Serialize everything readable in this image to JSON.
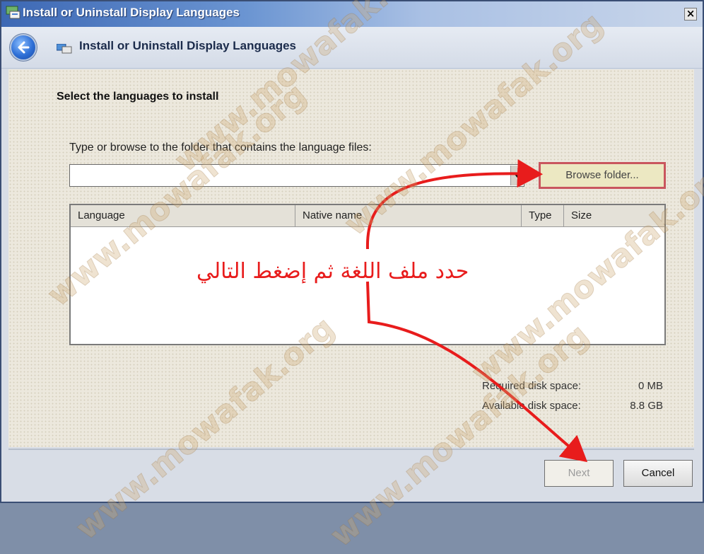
{
  "window": {
    "title": "Install or Uninstall Display Languages",
    "close_glyph": "×"
  },
  "navbar": {
    "back_icon": "back-arrow-icon",
    "title": "Install or Uninstall Display Languages"
  },
  "main": {
    "heading": "Select the languages to install",
    "folder_prompt": "Type or browse to the folder that contains the language files:",
    "folder_path_value": "",
    "browse_label": "Browse folder...",
    "columns": [
      "Language",
      "Native name",
      "Type",
      "Size"
    ],
    "rows": [],
    "required_label": "Required disk space:",
    "required_value": "0 MB",
    "available_label": "Available disk space:",
    "available_value": "8.8 GB"
  },
  "footer": {
    "next_label": "Next",
    "cancel_label": "Cancel"
  },
  "annotation": {
    "text": "حدد ملف اللغة ثم إضغط التالي",
    "color": "#e81c1c"
  },
  "watermark": "www.mowafak.org",
  "colors": {
    "title_bar": "#3d68b4",
    "highlight_border": "#c9565e",
    "annotation": "#e81c1c"
  }
}
